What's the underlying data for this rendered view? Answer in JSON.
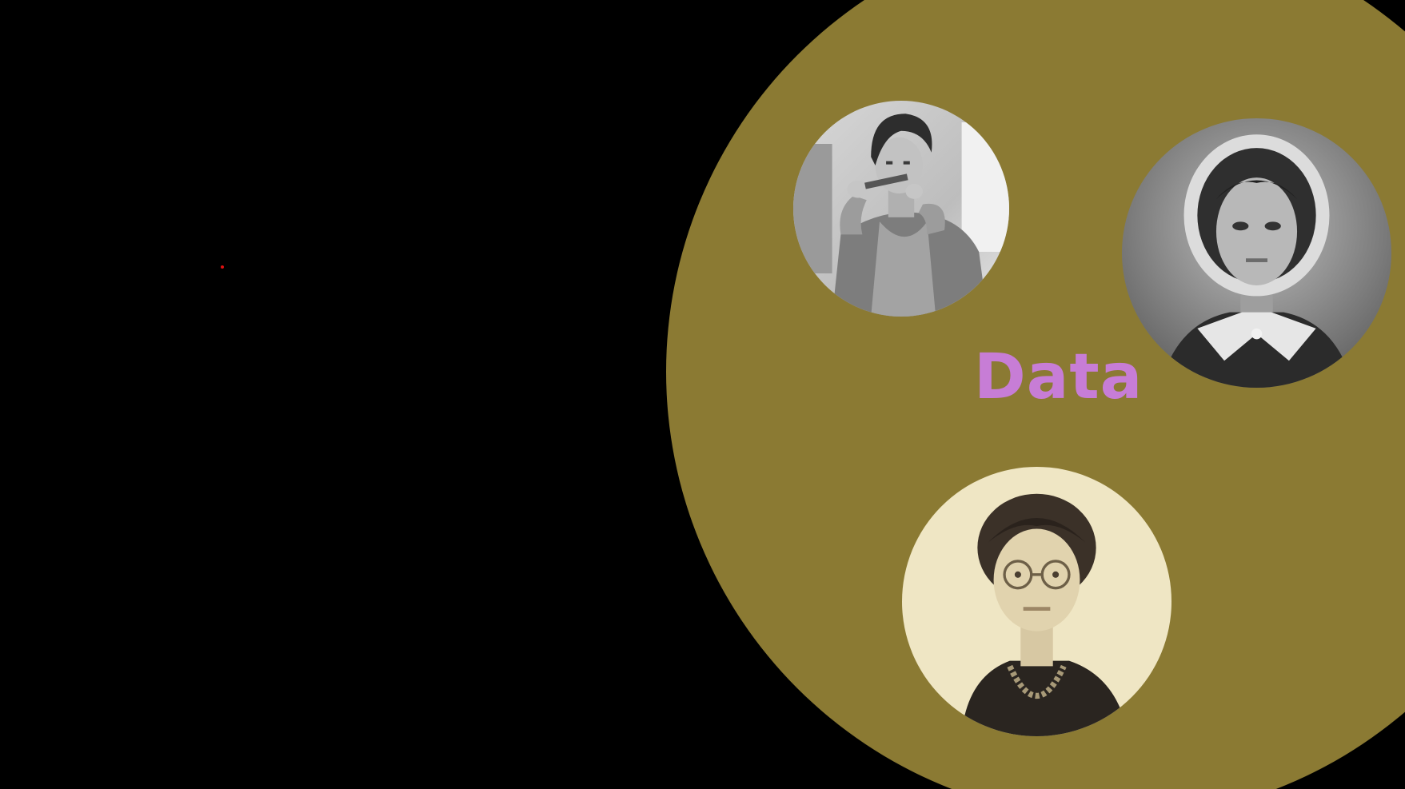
{
  "slide": {
    "label": "Data",
    "colors": {
      "background": "#000000",
      "circle": "#8b7a33",
      "label": "#c77dd6",
      "pointer": "#e01010"
    }
  },
  "portraits": [
    {
      "icon": "portrait-photo-woman-with-syringe",
      "style": "black-and-white"
    },
    {
      "icon": "portrait-photo-woman-with-lace-cap",
      "style": "black-and-white"
    },
    {
      "icon": "portrait-photo-woman-with-glasses-and-pearls",
      "style": "sepia"
    }
  ]
}
